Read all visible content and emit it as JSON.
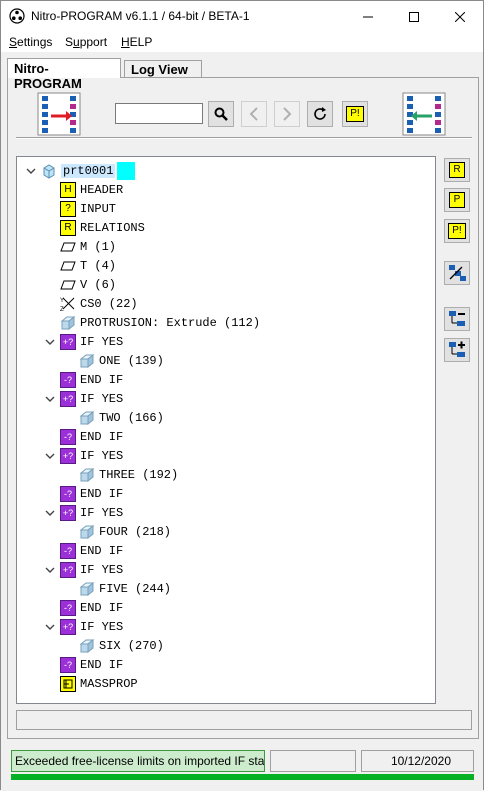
{
  "window": {
    "title": "Nitro-PROGRAM v6.1.1 / 64-bit / BETA-1"
  },
  "menu": {
    "items": [
      {
        "label": "Settings",
        "accel": "S"
      },
      {
        "label": "Support",
        "accel": "u"
      },
      {
        "label": "HELP",
        "accel": "H"
      }
    ]
  },
  "tabs": [
    {
      "label": "Nitro-PROGRAM",
      "active": true
    },
    {
      "label": "Log View",
      "active": false
    }
  ],
  "toolbar": {
    "search_value": "",
    "pbang_label": "P!"
  },
  "tree": {
    "nodes": [
      {
        "label": "prt0001",
        "icon": "part-icon",
        "expander": "expanded",
        "level": 0,
        "selected": true
      },
      {
        "label": "HEADER",
        "icon": "header-icon",
        "badge": "H",
        "level": 1
      },
      {
        "label": "INPUT",
        "icon": "input-icon",
        "badge": "?",
        "level": 1
      },
      {
        "label": "RELATIONS",
        "icon": "relations-icon",
        "badge": "R",
        "level": 1
      },
      {
        "label": "M (1)",
        "icon": "plane-icon",
        "level": 1
      },
      {
        "label": "T (4)",
        "icon": "plane-icon",
        "level": 1
      },
      {
        "label": "V (6)",
        "icon": "plane-icon",
        "level": 1
      },
      {
        "label": "CS0 (22)",
        "icon": "coordinate-system-icon",
        "level": 1
      },
      {
        "label": "PROTRUSION: Extrude (112)",
        "icon": "extrude-icon",
        "level": 1
      },
      {
        "label": "IF YES",
        "icon": "if-icon",
        "expander": "expanded",
        "level": 1
      },
      {
        "label": "ONE (139)",
        "icon": "extrude-icon",
        "level": 2
      },
      {
        "label": "END IF",
        "icon": "endif-icon",
        "level": 1
      },
      {
        "label": "IF YES",
        "icon": "if-icon",
        "expander": "expanded",
        "level": 1
      },
      {
        "label": "TWO (166)",
        "icon": "extrude-icon",
        "level": 2
      },
      {
        "label": "END IF",
        "icon": "endif-icon",
        "level": 1
      },
      {
        "label": "IF YES",
        "icon": "if-icon",
        "expander": "expanded",
        "level": 1
      },
      {
        "label": "THREE (192)",
        "icon": "extrude-icon",
        "level": 2
      },
      {
        "label": "END IF",
        "icon": "endif-icon",
        "level": 1
      },
      {
        "label": "IF YES",
        "icon": "if-icon",
        "expander": "expanded",
        "level": 1
      },
      {
        "label": "FOUR (218)",
        "icon": "extrude-icon",
        "level": 2
      },
      {
        "label": "END IF",
        "icon": "endif-icon",
        "level": 1
      },
      {
        "label": "IF YES",
        "icon": "if-icon",
        "expander": "expanded",
        "level": 1
      },
      {
        "label": "FIVE (244)",
        "icon": "extrude-icon",
        "level": 2
      },
      {
        "label": "END IF",
        "icon": "endif-icon",
        "level": 1
      },
      {
        "label": "IF YES",
        "icon": "if-icon",
        "expander": "expanded",
        "level": 1
      },
      {
        "label": "SIX (270)",
        "icon": "extrude-icon",
        "level": 2
      },
      {
        "label": "END IF",
        "icon": "endif-icon",
        "level": 1
      },
      {
        "label": "MASSPROP",
        "icon": "massprop-icon",
        "level": 1
      }
    ]
  },
  "sidebar": {
    "buttons": [
      {
        "label": "R",
        "icon": "relations-icon"
      },
      {
        "label": "P",
        "icon": "program-icon"
      },
      {
        "label": "P!",
        "icon": "program-run-icon"
      },
      {
        "label": "",
        "icon": "tree-sync-icon"
      },
      {
        "label": "",
        "icon": "collapse-tree-icon"
      },
      {
        "label": "",
        "icon": "expand-tree-icon"
      }
    ]
  },
  "status": {
    "message": "Exceeded free-license limits on imported IF statements",
    "middle": "",
    "date": "10/12/2020",
    "progress": 1.0
  },
  "colors": {
    "accent_green": "#06b025",
    "status_bg": "#cdeccd",
    "selection": "#cce8ff",
    "if_purple": "#9b30d9",
    "badge_yellow": "#ffff00",
    "cyan": "#00ffff"
  }
}
